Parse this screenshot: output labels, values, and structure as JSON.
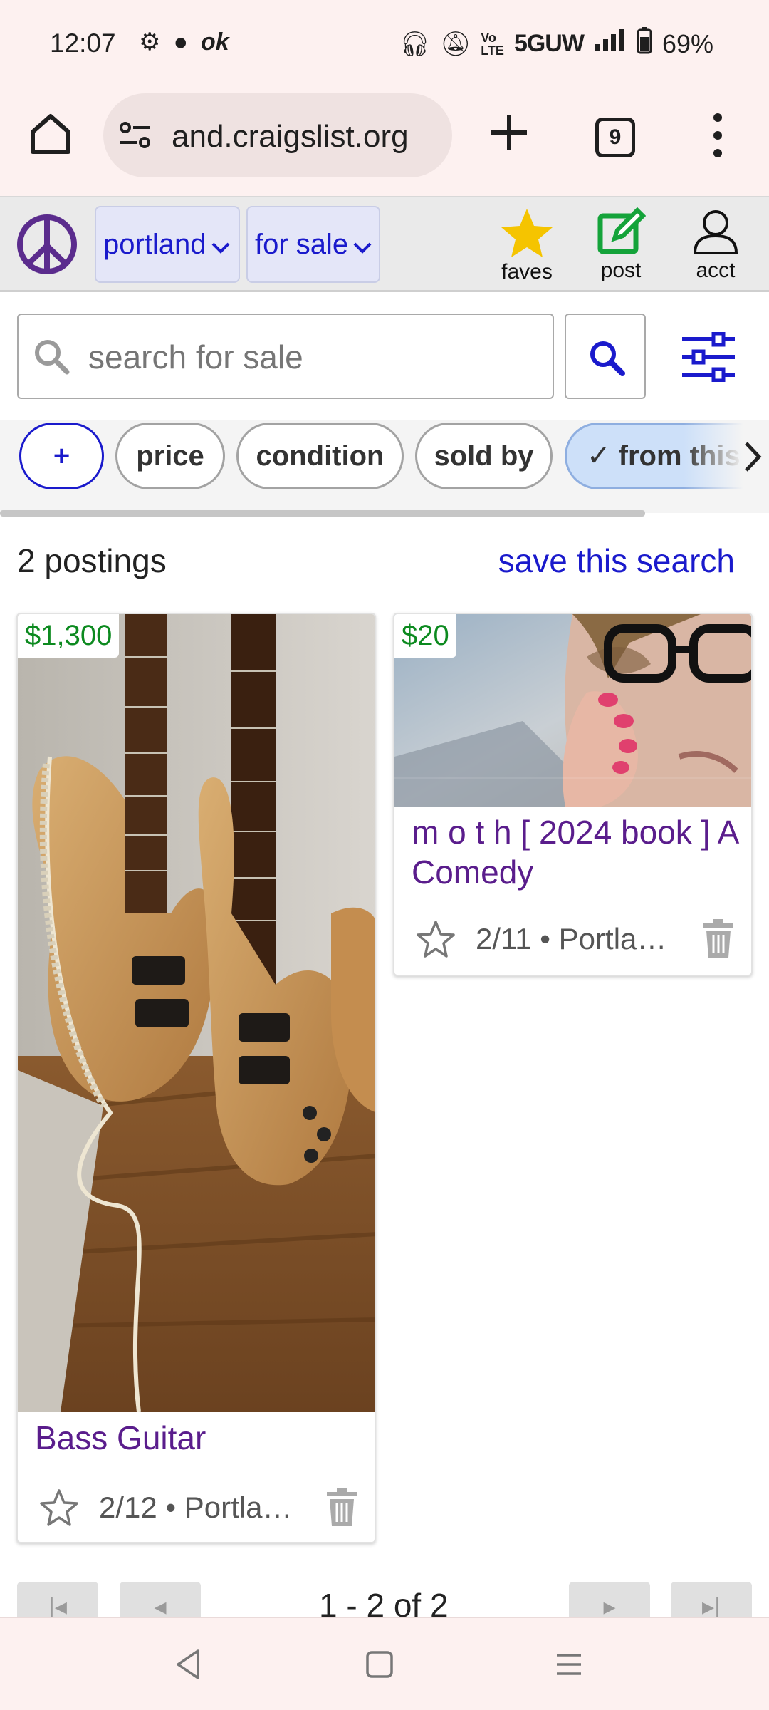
{
  "status_bar": {
    "time": "12:07",
    "network": "5GUW",
    "battery": "69%"
  },
  "browser": {
    "url": "and.craigslist.org",
    "tab_count": "9"
  },
  "header": {
    "city": "portland",
    "category": "for sale",
    "faves_label": "faves",
    "post_label": "post",
    "acct_label": "acct"
  },
  "search": {
    "placeholder": "search for sale"
  },
  "chips": {
    "add": "+",
    "price": "price",
    "condition": "condition",
    "sold_by": "sold by",
    "from_this": "✓ from this"
  },
  "results": {
    "count": "2 postings",
    "save_search": "save this search"
  },
  "postings": [
    {
      "price": "$1,300",
      "title": "Bass Guitar",
      "meta": "2/12 • Portla…"
    },
    {
      "price": "$20",
      "title": "m o t h [ 2024 book ] A Comedy",
      "meta": "2/11 • Portla…"
    }
  ],
  "pagination": {
    "label": "1 - 2 of 2"
  },
  "colors": {
    "link_blue": "#1a1acc",
    "visited_purple": "#5a1d8c",
    "price_green": "#0c8a1f",
    "logo_purple": "#5b2c8d",
    "post_green": "#14a33a",
    "faves_yellow": "#f5c400"
  },
  "icons": {
    "home": "home-icon",
    "site_settings": "tune-icon",
    "new_tab": "plus-icon",
    "menu": "more-vert-icon",
    "logo": "peace-icon",
    "faves": "star-icon",
    "post": "edit-icon",
    "acct": "person-icon",
    "search": "search-icon",
    "filters": "sliders-icon",
    "favorite": "star-outline-icon",
    "hide": "trash-icon"
  }
}
